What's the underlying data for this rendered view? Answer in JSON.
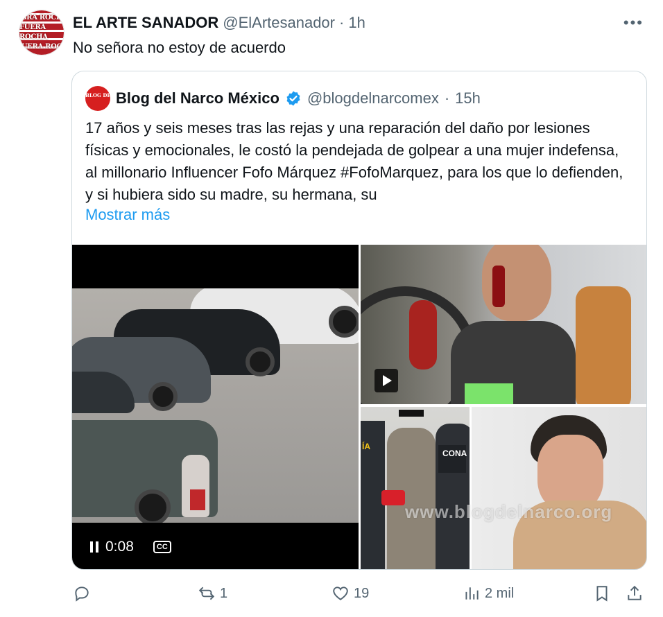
{
  "tweet": {
    "author_name": "EL ARTE SANADOR",
    "author_handle": "@ElArtesanador",
    "time": "1h",
    "separator": "·",
    "text": "No señora no estoy de acuerdo",
    "avatar_text": [
      "GRA ROCH",
      "FUERA ROCHA",
      "UERA ROC"
    ]
  },
  "quote": {
    "author_name": "Blog del Narco México",
    "author_handle": "@blogdelnarcomex",
    "time": "15h",
    "separator": "·",
    "avatar_text": "BLOG DEL NARCO",
    "text": "17 años y seis meses tras las rejas y una reparación del daño por lesiones físicas y emocionales, le costó la pendejada de golpear a una mujer indefensa, al millonario Influencer Fofo Márquez #FofoMarquez, para los que lo defienden, y si hubiera sido su madre, su hermana, su",
    "show_more": "Mostrar más",
    "video_time": "0:08",
    "cc_label": "CC",
    "watermark": "www.blogdelnarco.org",
    "vest_text": "CONA",
    "vest_text_left": "ÍA"
  },
  "actions": {
    "replies": "",
    "retweets": "1",
    "likes": "19",
    "views": "2 mil"
  },
  "colors": {
    "link": "#1d9bf0",
    "muted": "#536471",
    "verified": "#1d9bf0",
    "border": "#cfd9de"
  }
}
